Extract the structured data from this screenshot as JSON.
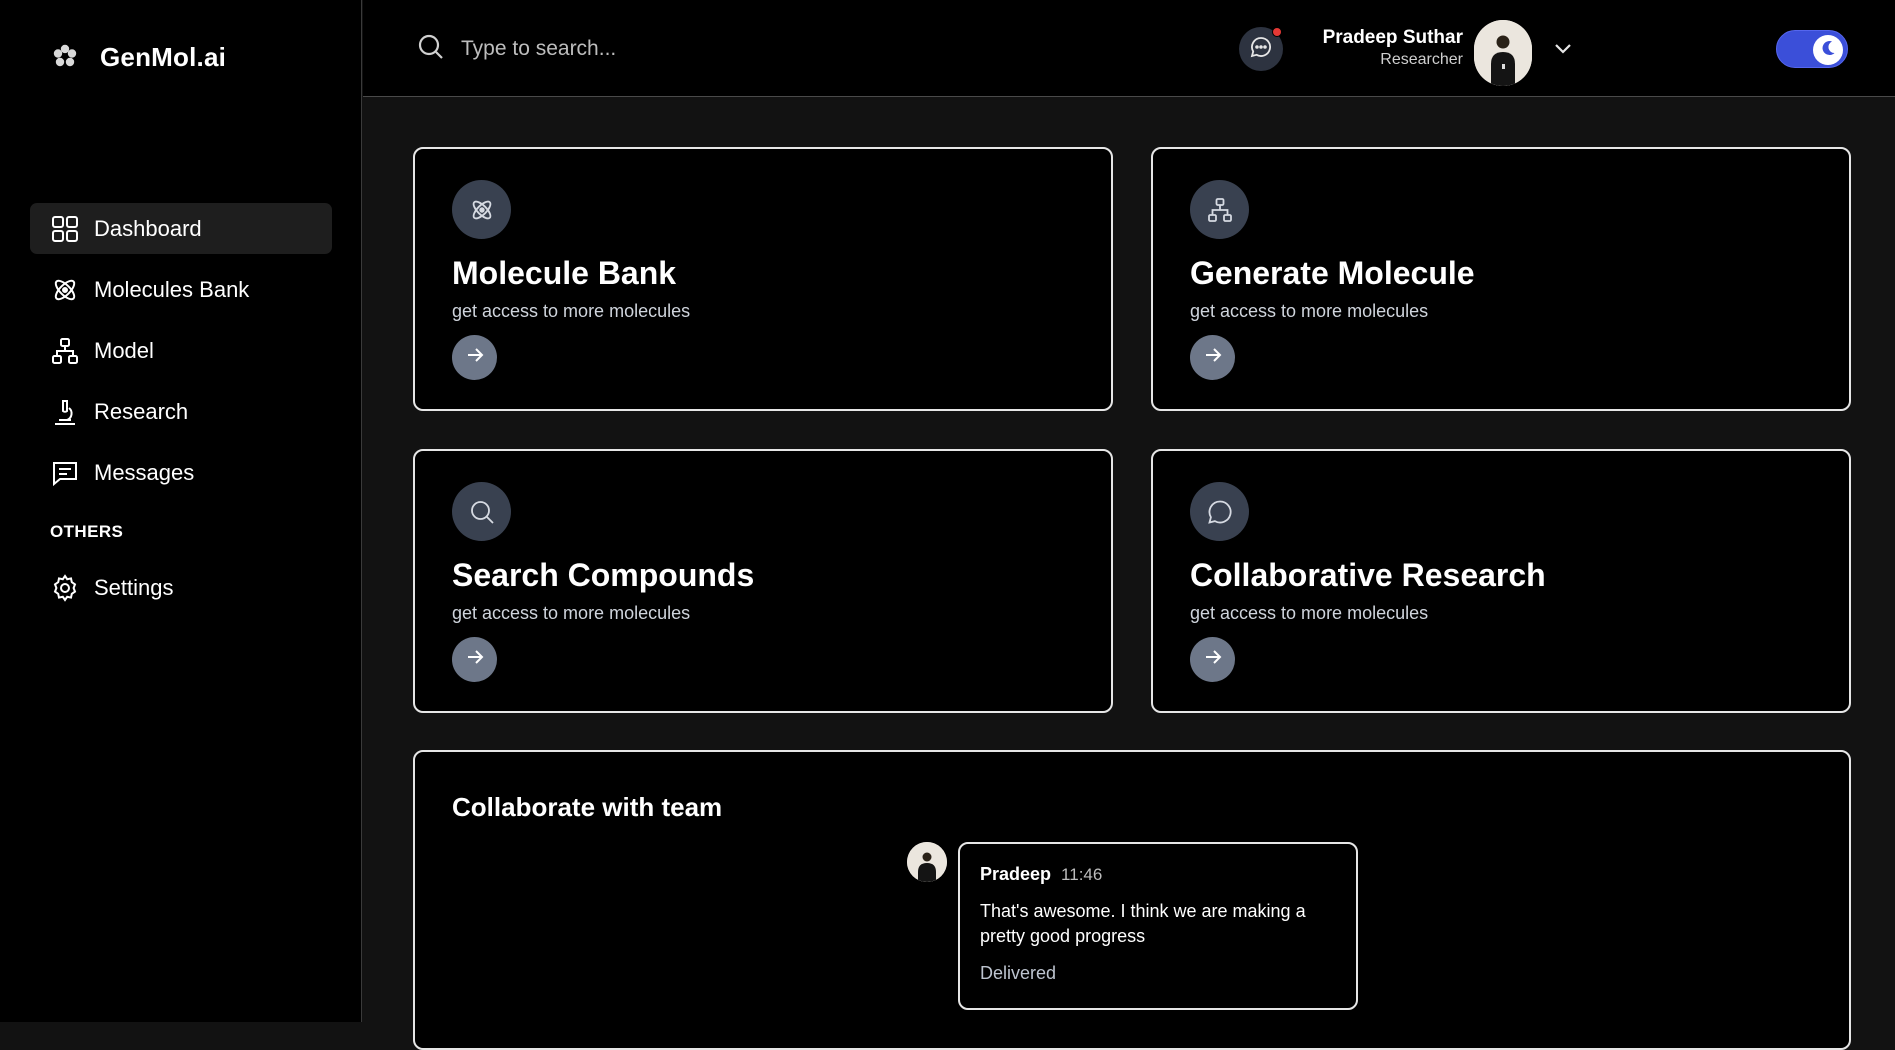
{
  "brand": {
    "name": "GenMol.ai",
    "icon": "flower-icon"
  },
  "sidebar": {
    "items": [
      {
        "label": "Dashboard",
        "icon": "grid-icon",
        "active": true
      },
      {
        "label": "Molecules Bank",
        "icon": "atom-icon",
        "active": false
      },
      {
        "label": "Model",
        "icon": "hierarchy-icon",
        "active": false
      },
      {
        "label": "Research",
        "icon": "microscope-icon",
        "active": false
      },
      {
        "label": "Messages",
        "icon": "message-icon",
        "active": false
      }
    ],
    "others_label": "OTHERS",
    "others_items": [
      {
        "label": "Settings",
        "icon": "gear-icon"
      }
    ]
  },
  "header": {
    "search_placeholder": "Type to search...",
    "user_name": "Pradeep Suthar",
    "user_role": "Researcher",
    "notification_color": "#e53935",
    "toggle_color": "#3b4fd9",
    "dark_mode": true
  },
  "cards": [
    {
      "title": "Molecule Bank",
      "subtitle": "get access to more molecules",
      "icon": "atom-icon"
    },
    {
      "title": "Generate Molecule",
      "subtitle": "get access to more molecules",
      "icon": "hierarchy-icon"
    },
    {
      "title": "Search Compounds",
      "subtitle": "get access to more molecules",
      "icon": "search-icon"
    },
    {
      "title": "Collaborative Research",
      "subtitle": "get access to more molecules",
      "icon": "chat-icon"
    }
  ],
  "collab": {
    "title": "Collaborate with team",
    "message": {
      "author": "Pradeep",
      "time": "11:46",
      "text": "That's awesome. I think we are making a pretty good progress",
      "status": "Delivered"
    }
  }
}
